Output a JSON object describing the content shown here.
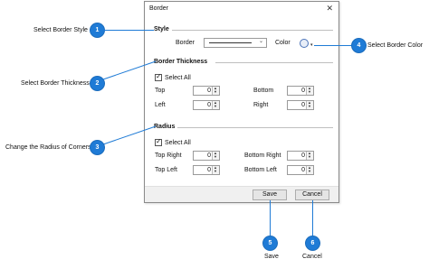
{
  "dialog": {
    "title": "Border",
    "close_glyph": "✕",
    "style_section": {
      "heading": "Style",
      "border_label": "Border",
      "border_value_glyph": "line",
      "color_label": "Color",
      "color_icon": "paint-bucket-icon"
    },
    "thickness_section": {
      "heading": "Border Thickness",
      "select_all_label": "Select All",
      "select_all_checked": true,
      "fields": [
        {
          "label": "Top",
          "value": "0"
        },
        {
          "label": "Bottom",
          "value": "0"
        },
        {
          "label": "Left",
          "value": "0"
        },
        {
          "label": "Right",
          "value": "0"
        }
      ]
    },
    "radius_section": {
      "heading": "Radius",
      "select_all_label": "Select All",
      "select_all_checked": true,
      "fields": [
        {
          "label": "Top Right",
          "value": "0"
        },
        {
          "label": "Bottom Right",
          "value": "0"
        },
        {
          "label": "Top Left",
          "value": "0"
        },
        {
          "label": "Bottom Left",
          "value": "0"
        }
      ]
    },
    "footer": {
      "save_label": "Save",
      "cancel_label": "Cancel"
    }
  },
  "callouts": [
    {
      "number": "1",
      "text": "Select Border Style"
    },
    {
      "number": "2",
      "text": "Select Border Thickness"
    },
    {
      "number": "3",
      "text": "Change the Radius of Corners"
    },
    {
      "number": "4",
      "text": "Select Border Color"
    },
    {
      "number": "5",
      "text": "Save"
    },
    {
      "number": "6",
      "text": "Cancel"
    }
  ],
  "colors": {
    "accent": "#1f7bd6",
    "dialog_border": "#8a8a8a",
    "footer_bg": "#f0f0f0"
  }
}
